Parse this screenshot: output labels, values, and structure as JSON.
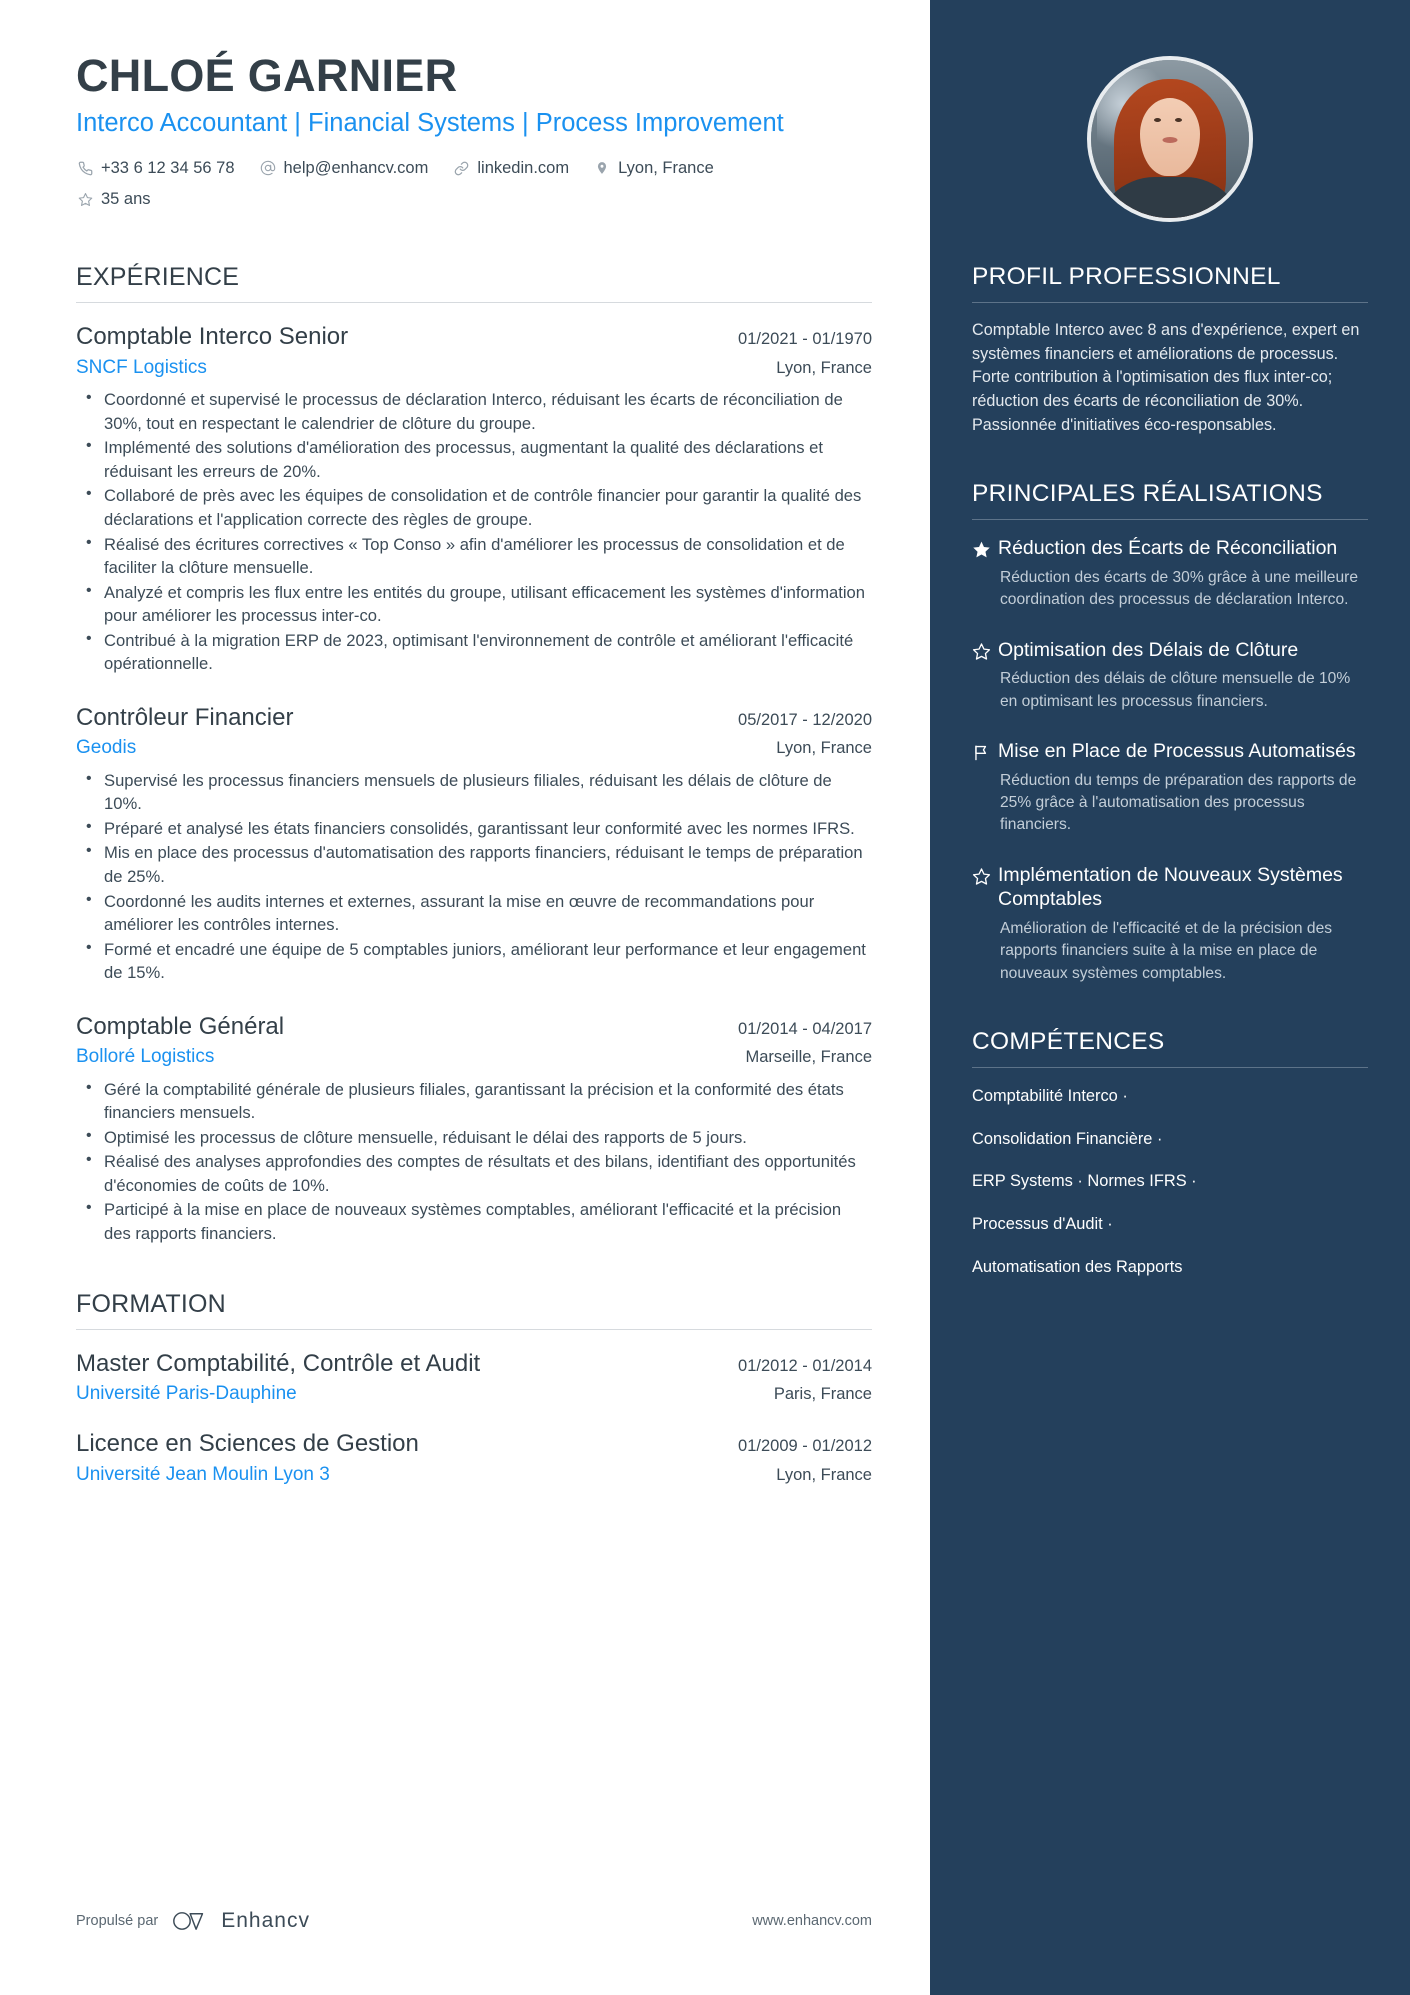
{
  "header": {
    "name": "CHLOÉ GARNIER",
    "headline": "Interco Accountant | Financial Systems | Process Improvement",
    "contacts": [
      {
        "icon": "phone-icon",
        "text": "+33 6 12 34 56 78"
      },
      {
        "icon": "email-icon",
        "text": "help@enhancv.com"
      },
      {
        "icon": "link-icon",
        "text": "linkedin.com"
      },
      {
        "icon": "location-pin-icon",
        "text": "Lyon, France"
      },
      {
        "icon": "star-outline-icon",
        "text": "35 ans"
      }
    ]
  },
  "experience": {
    "title": "EXPÉRIENCE",
    "entries": [
      {
        "title": "Comptable Interco Senior",
        "date": "01/2021 - 01/1970",
        "org": "SNCF Logistics",
        "location": "Lyon, France",
        "bullets": [
          "Coordonné et supervisé le processus de déclaration Interco, réduisant les écarts de réconciliation de 30%, tout en respectant le calendrier de clôture du groupe.",
          "Implémenté des solutions d'amélioration des processus, augmentant la qualité des déclarations et réduisant les erreurs de 20%.",
          "Collaboré de près avec les équipes de consolidation et de contrôle financier pour garantir la qualité des déclarations et l'application correcte des règles de groupe.",
          "Réalisé des écritures correctives « Top Conso » afin d'améliorer les processus de consolidation et de faciliter la clôture mensuelle.",
          "Analyzé et compris les flux entre les entités du groupe, utilisant efficacement les systèmes d'information pour améliorer les processus inter-co.",
          "Contribué à la migration ERP de 2023, optimisant l'environnement de contrôle et améliorant l'efficacité opérationnelle."
        ]
      },
      {
        "title": "Contrôleur Financier",
        "date": "05/2017 - 12/2020",
        "org": "Geodis",
        "location": "Lyon, France",
        "bullets": [
          "Supervisé les processus financiers mensuels de plusieurs filiales, réduisant les délais de clôture de 10%.",
          "Préparé et analysé les états financiers consolidés, garantissant leur conformité avec les normes IFRS.",
          "Mis en place des processus d'automatisation des rapports financiers, réduisant le temps de préparation de 25%.",
          "Coordonné les audits internes et externes, assurant la mise en œuvre de recommandations pour améliorer les contrôles internes.",
          "Formé et encadré une équipe de 5 comptables juniors, améliorant leur performance et leur engagement de 15%."
        ]
      },
      {
        "title": "Comptable Général",
        "date": "01/2014 - 04/2017",
        "org": "Bolloré Logistics",
        "location": "Marseille, France",
        "bullets": [
          "Géré la comptabilité générale de plusieurs filiales, garantissant la précision et la conformité des états financiers mensuels.",
          "Optimisé les processus de clôture mensuelle, réduisant le délai des rapports de 5 jours.",
          "Réalisé des analyses approfondies des comptes de résultats et des bilans, identifiant des opportunités d'économies de coûts de 10%.",
          "Participé à la mise en place de nouveaux systèmes comptables, améliorant l'efficacité et la précision des rapports financiers."
        ]
      }
    ]
  },
  "education": {
    "title": "FORMATION",
    "entries": [
      {
        "title": "Master Comptabilité, Contrôle et Audit",
        "date": "01/2012 - 01/2014",
        "org": "Université Paris-Dauphine",
        "location": "Paris, France"
      },
      {
        "title": "Licence en Sciences de Gestion",
        "date": "01/2009 - 01/2012",
        "org": "Université Jean Moulin Lyon 3",
        "location": "Lyon, France"
      }
    ]
  },
  "sidebar": {
    "profile": {
      "title": "PROFIL PROFESSIONNEL",
      "text": "Comptable Interco avec 8 ans d'expérience, expert en systèmes financiers et améliorations de processus. Forte contribution à l'optimisation des flux inter-co; réduction des écarts de réconciliation de 30%. Passionnée d'initiatives éco-responsables."
    },
    "achievements": {
      "title": "PRINCIPALES RÉALISATIONS",
      "items": [
        {
          "icon": "star-filled-icon",
          "title": "Réduction des Écarts de Réconciliation",
          "desc": "Réduction des écarts de 30% grâce à une meilleure coordination des processus de déclaration Interco."
        },
        {
          "icon": "star-outline-icon",
          "title": "Optimisation des Délais de Clôture",
          "desc": "Réduction des délais de clôture mensuelle de 10% en optimisant les processus financiers."
        },
        {
          "icon": "flag-icon",
          "title": "Mise en Place de Processus Automatisés",
          "desc": "Réduction du temps de préparation des rapports de 25% grâce à l'automatisation des processus financiers."
        },
        {
          "icon": "star-outline-icon",
          "title": "Implémentation de Nouveaux Systèmes Comptables",
          "desc": "Amélioration de l'efficacité et de la précision des rapports financiers suite à la mise en place de nouveaux systèmes comptables."
        }
      ]
    },
    "skills": {
      "title": "COMPÉTENCES",
      "lines": [
        "Comptabilité Interco ·",
        "Consolidation Financière ·",
        "ERP Systems · Normes IFRS ·",
        "Processus d'Audit ·",
        "Automatisation des Rapports"
      ]
    }
  },
  "footer": {
    "powered_by": "Propulsé par",
    "brand": "Enhancv",
    "website": "www.enhancv.com"
  },
  "colors": {
    "accent_blue": "#1a91f0",
    "sidebar_bg": "#24405c",
    "text_dark": "#333f48"
  }
}
